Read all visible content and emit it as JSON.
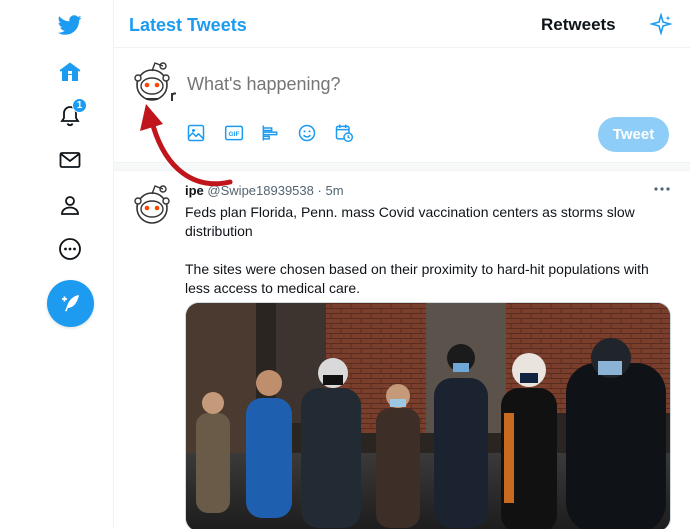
{
  "nav": {
    "notifications_badge": "1",
    "items": [
      {
        "name": "twitter-logo-icon"
      },
      {
        "name": "home-icon"
      },
      {
        "name": "bell-icon"
      },
      {
        "name": "mail-icon"
      },
      {
        "name": "profile-icon"
      },
      {
        "name": "more-circle-icon"
      },
      {
        "name": "compose-feather-icon"
      }
    ]
  },
  "header": {
    "title": "Latest Tweets",
    "retweets_label": "Retweets",
    "sparkle_icon": "sparkle-icon"
  },
  "composer": {
    "placeholder": "What's happening?",
    "tweet_button": "Tweet",
    "tools": [
      "image-icon",
      "gif-icon",
      "poll-icon",
      "emoji-icon",
      "schedule-icon"
    ]
  },
  "tweet": {
    "name_partial": "ipe",
    "handle": "@Swipe18939538",
    "separator": "·",
    "time": "5m",
    "text_1": "Feds plan Florida, Penn. mass Covid vaccination centers as storms slow distribution",
    "text_2": "The sites were chosen based on their proximity to hard-hit populations with less access to medical care."
  },
  "colors": {
    "accent": "#1d9bf0",
    "tweet_button_disabled": "#8ecdf8",
    "annotation_arrow": "#c0151a"
  }
}
